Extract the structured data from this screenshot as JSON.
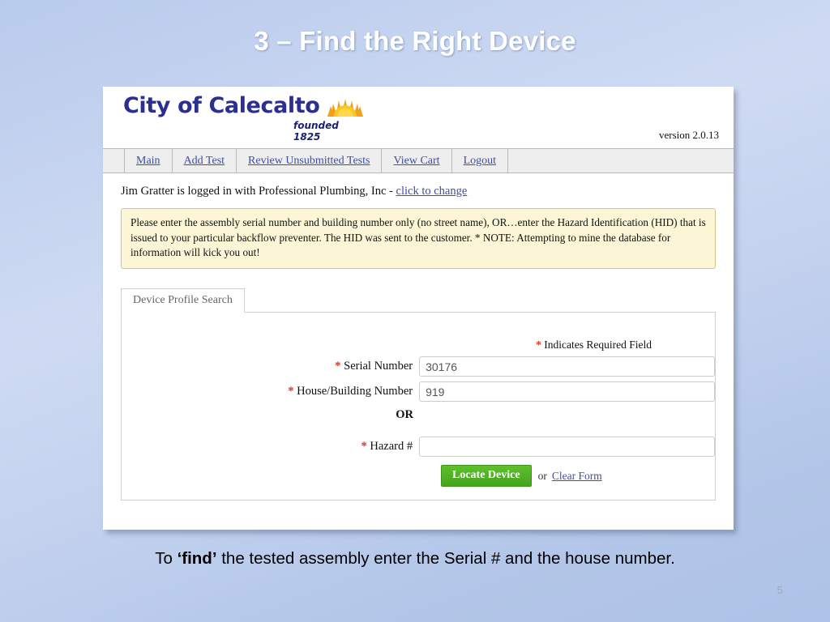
{
  "slide": {
    "title": "3 – Find the Right Device",
    "caption_pre": "To ",
    "caption_bold": "‘find’",
    "caption_post": " the tested assembly enter the Serial # and the house number.",
    "page_number": "5",
    "background_color": "#c3d2ef"
  },
  "app": {
    "logo_text": "City of Calecalto",
    "logo_founded": "founded 1825",
    "logo_color": "#2b2f8f",
    "sun_colors": {
      "outer": "#f5a623",
      "inner": "#fdcb2e"
    },
    "version": "version 2.0.13",
    "nav": [
      {
        "label": "Main",
        "name": "nav-main"
      },
      {
        "label": "Add Test",
        "name": "nav-add-test"
      },
      {
        "label": "Review Unsubmitted Tests",
        "name": "nav-review-unsubmitted-tests"
      },
      {
        "label": "View Cart",
        "name": "nav-view-cart"
      },
      {
        "label": "Logout",
        "name": "nav-logout"
      }
    ],
    "login": {
      "text": "Jim Gratter is logged in with Professional Plumbing, Inc - ",
      "link": "click to change"
    },
    "notice": "Please enter the assembly serial number and building number only (no street name), OR…enter the Hazard Identification (HID) that is issued to your particular backflow preventer. The HID was sent to the customer. * NOTE: Attempting to mine the database for information will kick you out!",
    "notice_bg": "#fdf6d6",
    "notice_border": "#d4c48a"
  },
  "form": {
    "tab_label": "Device Profile Search",
    "required_star": "*",
    "required_note": " Indicates Required Field",
    "fields": [
      {
        "label": "Serial Number",
        "value": "30176",
        "placeholder": ""
      },
      {
        "label": "House/Building Number",
        "value": "919",
        "placeholder": ""
      },
      {
        "label": "Hazard #",
        "value": "",
        "placeholder": ""
      }
    ],
    "or_divider": "OR",
    "submit_label": "Locate Device",
    "submit_color": "#4fb024",
    "or_small": "or",
    "clear_label": "Clear Form"
  }
}
